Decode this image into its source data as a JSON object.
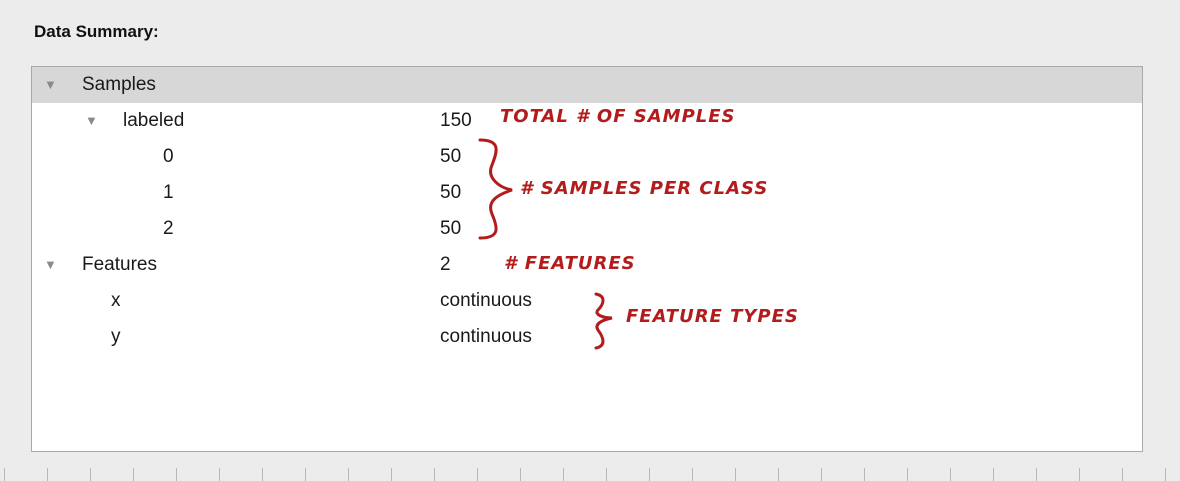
{
  "summary": {
    "title": "Data Summary:",
    "tree": {
      "samples": {
        "label": "Samples",
        "labeled": {
          "label": "labeled",
          "value": "150",
          "classes": [
            {
              "label": "0",
              "value": "50"
            },
            {
              "label": "1",
              "value": "50"
            },
            {
              "label": "2",
              "value": "50"
            }
          ]
        }
      },
      "features": {
        "label": "Features",
        "value": "2",
        "items": [
          {
            "label": "x",
            "value": "continuous"
          },
          {
            "label": "y",
            "value": "continuous"
          }
        ]
      }
    }
  },
  "annotations": {
    "total_samples": "TOTAL # OF SAMPLES",
    "samples_per_class": "# SAMPLES PER CLASS",
    "features": "# FEATURES",
    "feature_types": "FEATURE TYPES"
  },
  "colors": {
    "annotation": "#b31c1c",
    "selected_row": "#d7d7d7",
    "panel_bg": "#ffffff",
    "window_bg": "#ececec"
  },
  "icons": {
    "expanded": "disclosure-triangle-expanded-icon"
  }
}
